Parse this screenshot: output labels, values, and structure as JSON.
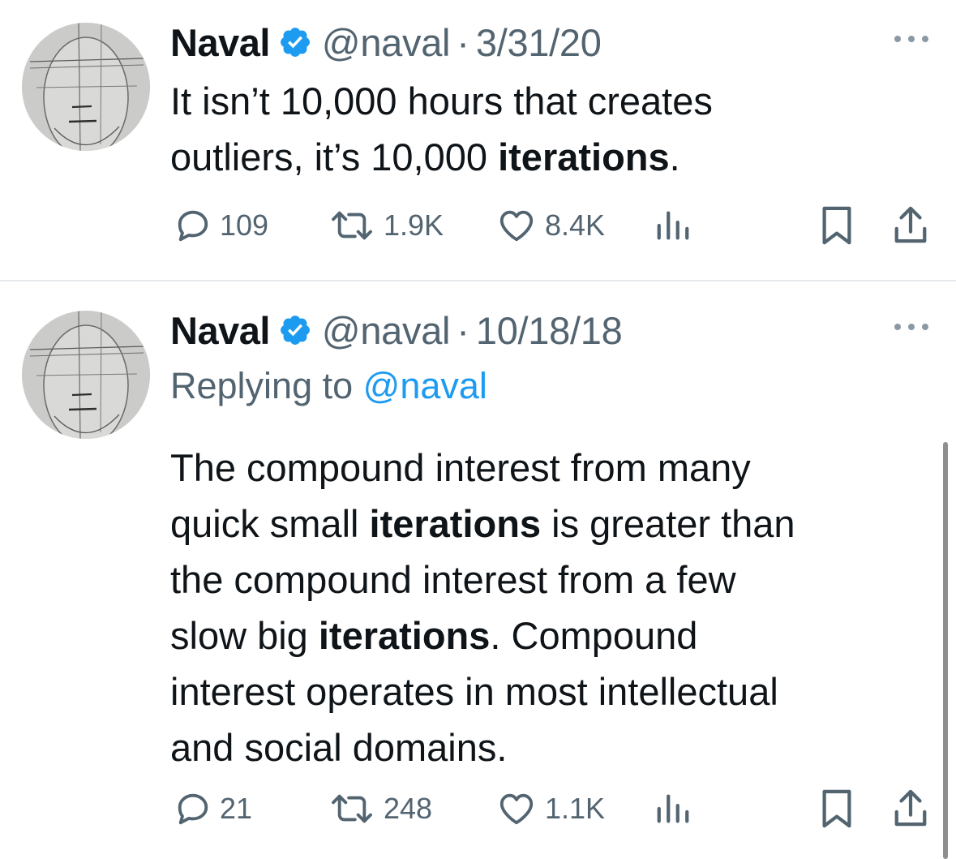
{
  "colors": {
    "text": "#0f1419",
    "secondary": "#536471",
    "accent": "#1d9bf0",
    "divider": "#e6e9ec"
  },
  "tweets": [
    {
      "name": "Naval",
      "verified_icon": "verified-badge-icon",
      "handle": "@naval",
      "separator": "·",
      "date": "3/31/20",
      "lines": [
        [
          {
            "t": "It isn’t 10,000 hours that creates"
          }
        ],
        [
          {
            "t": "outliers, it’s 10,000 "
          },
          {
            "t": "iterations",
            "b": true
          },
          {
            "t": "."
          }
        ]
      ],
      "stats": {
        "replies": "109",
        "retweets": "1.9K",
        "likes": "8.4K"
      }
    },
    {
      "name": "Naval",
      "verified_icon": "verified-badge-icon",
      "handle": "@naval",
      "separator": "·",
      "date": "10/18/18",
      "replying_prefix": "Replying to ",
      "replying_to": "@naval",
      "lines": [
        [
          {
            "t": "The compound interest from many"
          }
        ],
        [
          {
            "t": "quick small "
          },
          {
            "t": "iterations",
            "b": true
          },
          {
            "t": " is greater than"
          }
        ],
        [
          {
            "t": "the compound interest from a few"
          }
        ],
        [
          {
            "t": "slow big "
          },
          {
            "t": "iterations",
            "b": true
          },
          {
            "t": ". Compound"
          }
        ],
        [
          {
            "t": "interest operates in most intellectual"
          }
        ],
        [
          {
            "t": "and social domains."
          }
        ]
      ],
      "stats": {
        "replies": "21",
        "retweets": "248",
        "likes": "1.1K"
      }
    }
  ]
}
